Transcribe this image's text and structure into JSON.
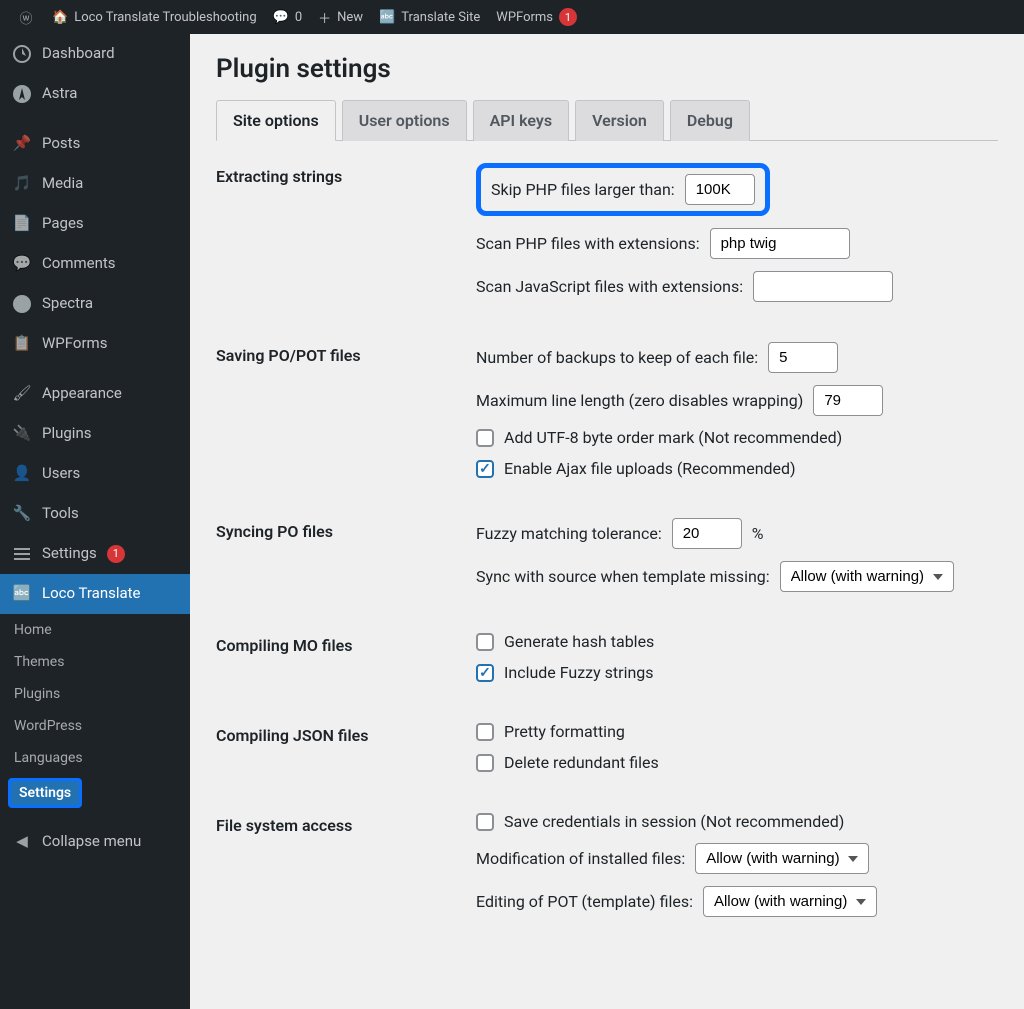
{
  "adminbar": {
    "site_title": "Loco Translate Troubleshooting",
    "comments_count": "0",
    "new_label": "New",
    "translate_site": "Translate Site",
    "wpforms_label": "WPForms",
    "wpforms_badge": "1"
  },
  "sidebar": {
    "items": [
      {
        "icon": "dashboard",
        "label": "Dashboard"
      },
      {
        "icon": "astra",
        "label": "Astra"
      },
      {
        "icon": "pin",
        "label": "Posts"
      },
      {
        "icon": "media",
        "label": "Media"
      },
      {
        "icon": "page",
        "label": "Pages"
      },
      {
        "icon": "comment",
        "label": "Comments"
      },
      {
        "icon": "spectra",
        "label": "Spectra"
      },
      {
        "icon": "wpforms",
        "label": "WPForms"
      },
      {
        "icon": "brush",
        "label": "Appearance"
      },
      {
        "icon": "plug",
        "label": "Plugins"
      },
      {
        "icon": "user",
        "label": "Users"
      },
      {
        "icon": "wrench",
        "label": "Tools"
      },
      {
        "icon": "sliders",
        "label": "Settings",
        "badge": "1"
      },
      {
        "icon": "loco",
        "label": "Loco Translate",
        "current": true
      }
    ],
    "subs": [
      "Home",
      "Themes",
      "Plugins",
      "WordPress",
      "Languages",
      "Settings"
    ],
    "collapse": "Collapse menu"
  },
  "page": {
    "title": "Plugin settings",
    "tabs": [
      "Site options",
      "User options",
      "API keys",
      "Version",
      "Debug"
    ],
    "sections": {
      "extracting": {
        "label": "Extracting strings",
        "skip_label": "Skip PHP files larger than:",
        "skip_value": "100K",
        "scan_php_label": "Scan PHP files with extensions:",
        "scan_php_value": "php twig",
        "scan_js_label": "Scan JavaScript files with extensions:",
        "scan_js_value": ""
      },
      "saving": {
        "label": "Saving PO/POT files",
        "backups_label": "Number of backups to keep of each file:",
        "backups_value": "5",
        "maxline_label": "Maximum line length (zero disables wrapping)",
        "maxline_value": "79",
        "utf8_label": "Add UTF-8 byte order mark (Not recommended)",
        "ajax_label": "Enable Ajax file uploads (Recommended)"
      },
      "syncing": {
        "label": "Syncing PO files",
        "fuzzy_label": "Fuzzy matching tolerance:",
        "fuzzy_value": "20",
        "fuzzy_suffix": "%",
        "sync_label": "Sync with source when template missing:",
        "sync_value": "Allow (with warning)"
      },
      "compiling_mo": {
        "label": "Compiling MO files",
        "hash_label": "Generate hash tables",
        "fuzzy_label": "Include Fuzzy strings"
      },
      "compiling_json": {
        "label": "Compiling JSON files",
        "pretty_label": "Pretty formatting",
        "delete_label": "Delete redundant files"
      },
      "fs": {
        "label": "File system access",
        "creds_label": "Save credentials in session (Not recommended)",
        "mod_label": "Modification of installed files:",
        "mod_value": "Allow (with warning)",
        "pot_label": "Editing of POT (template) files:",
        "pot_value": "Allow (with warning)"
      }
    }
  }
}
